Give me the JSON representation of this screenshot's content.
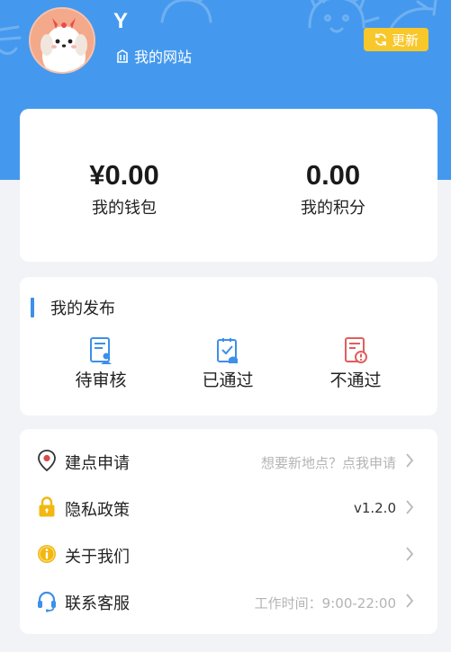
{
  "header": {
    "username": "Y",
    "site_label": "我的网站",
    "refresh_label": "更新"
  },
  "wallet": {
    "balance": "¥0.00",
    "balance_label": "我的钱包",
    "points": "0.00",
    "points_label": "我的积分"
  },
  "publish": {
    "title": "我的发布",
    "items": [
      {
        "label": "待审核",
        "icon": "pending-review-icon"
      },
      {
        "label": "已通过",
        "icon": "approved-icon"
      },
      {
        "label": "不通过",
        "icon": "rejected-icon"
      }
    ]
  },
  "menu": {
    "items": [
      {
        "title": "建点申请",
        "value": "想要新地点？点我申请",
        "icon": "location-pin-icon"
      },
      {
        "title": "隐私政策",
        "value": "v1.2.0",
        "icon": "lock-icon"
      },
      {
        "title": "关于我们",
        "value": "",
        "icon": "info-icon"
      },
      {
        "title": "联系客服",
        "value": "工作时间：9:00-22:00",
        "icon": "headset-icon"
      }
    ]
  },
  "colors": {
    "header_blue": "#4499ee",
    "accent_yellow": "#f8c72a",
    "icon_blue": "#3d8fe9",
    "reject_red": "#e35d5d",
    "pin_red": "#d64b4b",
    "gold": "#f2b80f"
  }
}
